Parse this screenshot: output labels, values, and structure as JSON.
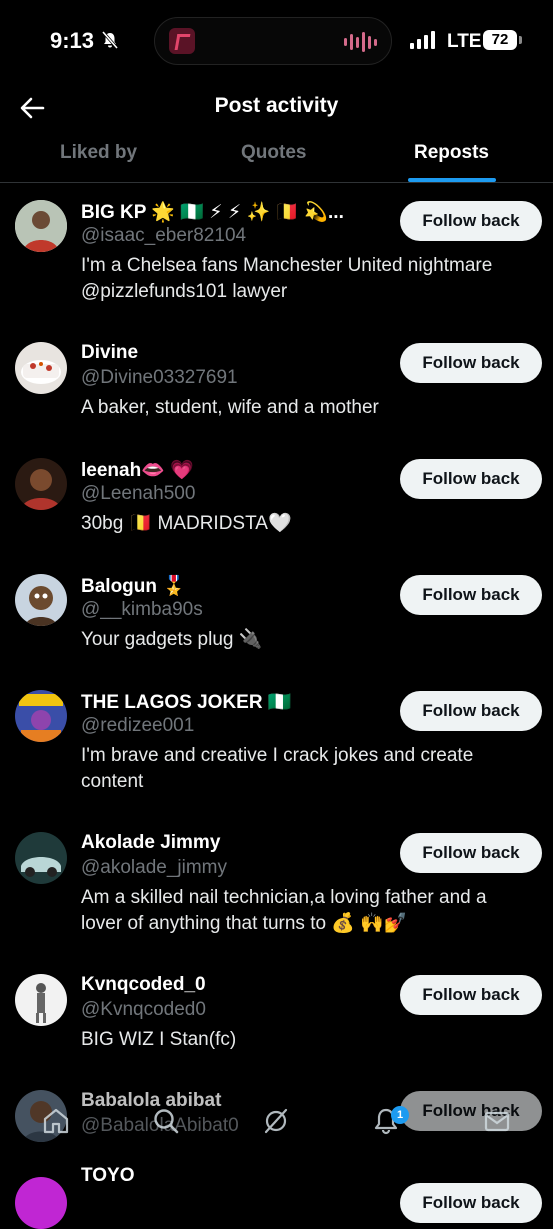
{
  "status_bar": {
    "time": "9:13",
    "network": "LTE",
    "battery": "72"
  },
  "header": {
    "title": "Post activity"
  },
  "tabs": [
    {
      "label": "Liked by"
    },
    {
      "label": "Quotes"
    },
    {
      "label": "Reposts",
      "active": true
    }
  ],
  "colors": {
    "accent": "#1d9bf0",
    "background": "#000000",
    "secondary_text": "#71767b"
  },
  "users": [
    {
      "name": "BIG KP 🌟 🇳🇬 ⚡ ⚡ ✨ 🇧🇪 💫...",
      "handle": "@isaac_eber82104",
      "bio": "I'm a Chelsea fans Manchester United nightmare @pizzlefunds101 lawyer",
      "button": "Follow back"
    },
    {
      "name": "Divine",
      "handle": "@Divine03327691",
      "bio": "A baker, student, wife and a mother",
      "button": "Follow back"
    },
    {
      "name": "leenah👄 💗",
      "handle": "@Leenah500",
      "bio": "30bg 🇧🇪 MADRIDSTA🤍",
      "button": "Follow back"
    },
    {
      "name": "Balogun 🎖️",
      "handle": "@__kimba90s",
      "bio": "Your gadgets plug 🔌",
      "button": "Follow back"
    },
    {
      "name": "THE LAGOS JOKER 🇳🇬",
      "handle": "@redizee001",
      "bio": "I'm brave and creative I crack jokes and create content",
      "button": "Follow back"
    },
    {
      "name": "Akolade Jimmy",
      "handle": "@akolade_jimmy",
      "bio": "Am a skilled nail technician,a loving father and a lover of anything that turns to 💰 🙌💅",
      "button": "Follow back"
    },
    {
      "name": "Kvnqcoded_0",
      "handle": "@Kvnqcoded0",
      "bio": "BIG WIZ I Stan(fc)",
      "button": "Follow back"
    },
    {
      "name": "Babalola abibat",
      "handle": "@BabalolaAbibat0",
      "bio": "",
      "button": "Follow back"
    },
    {
      "name": "TOYO",
      "handle": "",
      "bio": "",
      "button": "Follow back"
    }
  ],
  "bottom_nav": [
    {
      "icon": "home-icon"
    },
    {
      "icon": "search-icon"
    },
    {
      "icon": "grok-icon"
    },
    {
      "icon": "notifications-icon",
      "badge": "1"
    },
    {
      "icon": "messages-icon"
    }
  ]
}
